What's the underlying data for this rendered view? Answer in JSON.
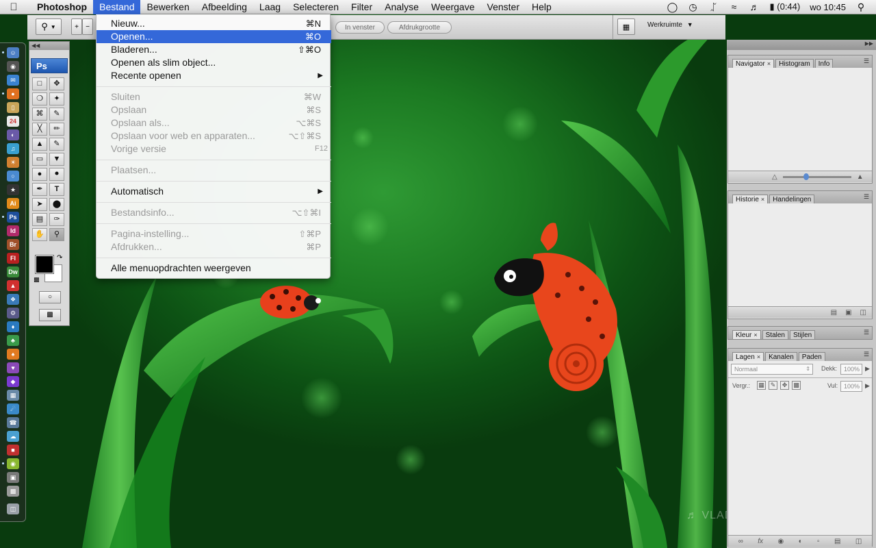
{
  "menubar": {
    "app_name": "Photoshop",
    "menus": [
      "Bestand",
      "Bewerken",
      "Afbeelding",
      "Laag",
      "Selecteren",
      "Filter",
      "Analyse",
      "Weergave",
      "Venster",
      "Help"
    ],
    "active_menu": "Bestand",
    "battery": "(0:44)",
    "clock": "wo 10:45"
  },
  "optionsbar": {
    "fit_window": "In venster",
    "print_size": "Afdrukgrootte",
    "workspace": "Werkruimte"
  },
  "file_menu": {
    "items": [
      {
        "label": "Nieuw...",
        "shortcut": "⌘N",
        "enabled": true
      },
      {
        "label": "Openen...",
        "shortcut": "⌘O",
        "enabled": true,
        "highlighted": true
      },
      {
        "label": "Bladeren...",
        "shortcut": "⇧⌘O",
        "enabled": true
      },
      {
        "label": "Openen als slim object...",
        "shortcut": "",
        "enabled": true
      },
      {
        "label": "Recente openen",
        "shortcut": "",
        "enabled": true,
        "submenu": true
      },
      {
        "label": "Sluiten",
        "shortcut": "⌘W",
        "enabled": false
      },
      {
        "label": "Opslaan",
        "shortcut": "⌘S",
        "enabled": false
      },
      {
        "label": "Opslaan als...",
        "shortcut": "⌥⌘S",
        "enabled": false
      },
      {
        "label": "Opslaan voor web en apparaten...",
        "shortcut": "⌥⇧⌘S",
        "enabled": false
      },
      {
        "label": "Vorige versie",
        "shortcut": "F12",
        "enabled": false
      },
      {
        "label": "Plaatsen...",
        "shortcut": "",
        "enabled": false
      },
      {
        "label": "Automatisch",
        "shortcut": "",
        "enabled": true,
        "submenu": true
      },
      {
        "label": "Bestandsinfo...",
        "shortcut": "⌥⇧⌘I",
        "enabled": false
      },
      {
        "label": "Pagina-instelling...",
        "shortcut": "⇧⌘P",
        "enabled": false
      },
      {
        "label": "Afdrukken...",
        "shortcut": "⌘P",
        "enabled": false
      },
      {
        "label": "Alle menuopdrachten weergeven",
        "shortcut": "",
        "enabled": true
      }
    ]
  },
  "tools": {
    "logo": "Ps"
  },
  "panels": {
    "navigator": {
      "tabs": [
        "Navigator",
        "Histogram",
        "Info"
      ]
    },
    "history": {
      "tabs": [
        "Historie",
        "Handelingen"
      ]
    },
    "color": {
      "tabs": [
        "Kleur",
        "Stalen",
        "Stijlen"
      ]
    },
    "layers": {
      "tabs": [
        "Lagen",
        "Kanalen",
        "Paden"
      ],
      "blend_mode": "Normaal",
      "opacity_label": "Dekk:",
      "opacity_value": "100%",
      "lock_label": "Vergr.:",
      "fill_label": "Vul:",
      "fill_value": "100%"
    }
  },
  "dock": {
    "labels": [
      "Ai",
      "Ps",
      "Id",
      "Br",
      "Fl",
      "Dw"
    ],
    "calendar_day": "24"
  },
  "watermark": "VLAD",
  "colors": {
    "menu_highlight": "#3468d9",
    "wallpaper_green": "#1c7a22"
  }
}
